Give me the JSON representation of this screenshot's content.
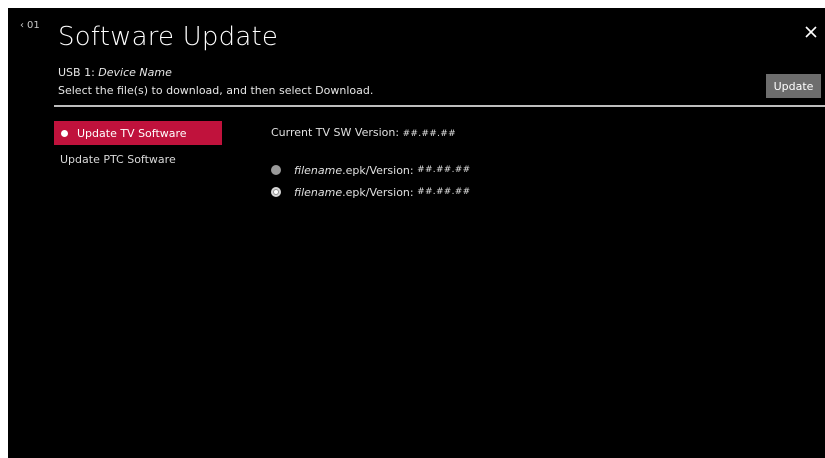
{
  "header": {
    "back_number": "01",
    "title": "Software Update",
    "device_prefix": "USB 1:",
    "device_name": "Device Name",
    "instruction": "Select the file(s) to download, and then select Download.",
    "update_label": "Update"
  },
  "nav": {
    "items": [
      {
        "label": "Update TV Software",
        "active": true
      },
      {
        "label": "Update PTC Software",
        "active": false
      }
    ]
  },
  "main": {
    "current_label": "Current TV SW Version:",
    "current_value": "##.##.##",
    "files": [
      {
        "name": "filename",
        "suffix": ".epk/Version:",
        "version": "##.##.##",
        "selected": false
      },
      {
        "name": "filename",
        "suffix": ".epk/Version:",
        "version": "##.##.##",
        "selected": true
      }
    ]
  },
  "colors": {
    "accent": "#c0123c",
    "background": "#000000",
    "button": "#6d6d6d"
  },
  "icons": {
    "back": "chevron-left-icon",
    "close": "close-icon"
  }
}
